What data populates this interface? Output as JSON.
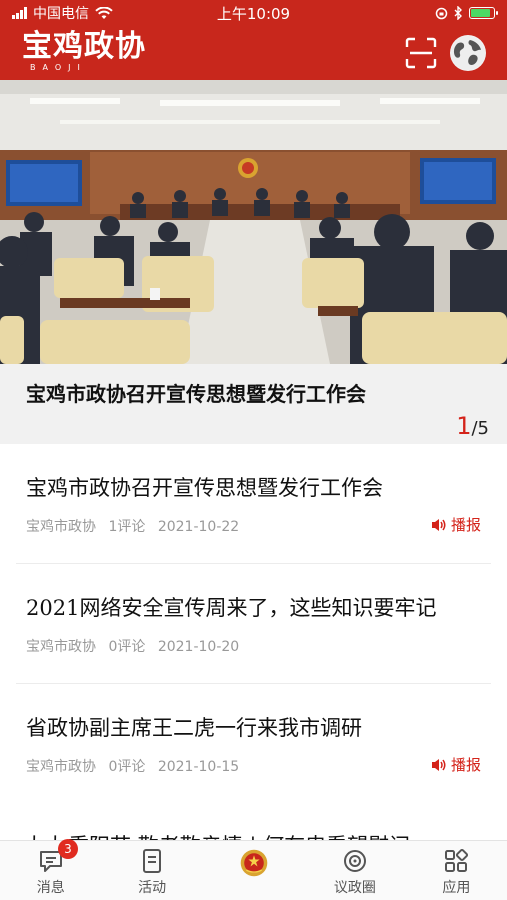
{
  "status": {
    "carrier": "中国电信",
    "time": "上午10:09"
  },
  "header": {
    "logo_text": "宝鸡政协",
    "logo_subtext": "BAOJI"
  },
  "banner": {
    "caption": "宝鸡市政协召开宣传思想暨发行工作会",
    "pager_current": "1",
    "pager_total": "/5"
  },
  "news": [
    {
      "title": "宝鸡市政协召开宣传思想暨发行工作会",
      "source": "宝鸡市政协",
      "comments": "1评论",
      "date": "2021-10-22",
      "broadcast": "播报"
    },
    {
      "title": "2021网络安全宣传周来了，这些知识要牢记",
      "source": "宝鸡市政协",
      "comments": "0评论",
      "date": "2021-10-20",
      "broadcast": ""
    },
    {
      "title": "省政协副主席王二虎一行来我市调研",
      "source": "宝鸡市政协",
      "comments": "0评论",
      "date": "2021-10-15",
      "broadcast": "播报"
    }
  ],
  "partial_title": "九九重阳节 敬老敬亲情 | 何有忠看望慰问",
  "tabs": [
    {
      "label": "消息",
      "badge": "3",
      "icon": "message-icon"
    },
    {
      "label": "活动",
      "icon": "activity-icon"
    },
    {
      "label": "",
      "icon": "emblem-icon"
    },
    {
      "label": "议政圈",
      "icon": "circle-icon"
    },
    {
      "label": "应用",
      "icon": "apps-icon"
    }
  ],
  "colors": {
    "brand": "#c8271c",
    "accent": "#d4231a"
  }
}
